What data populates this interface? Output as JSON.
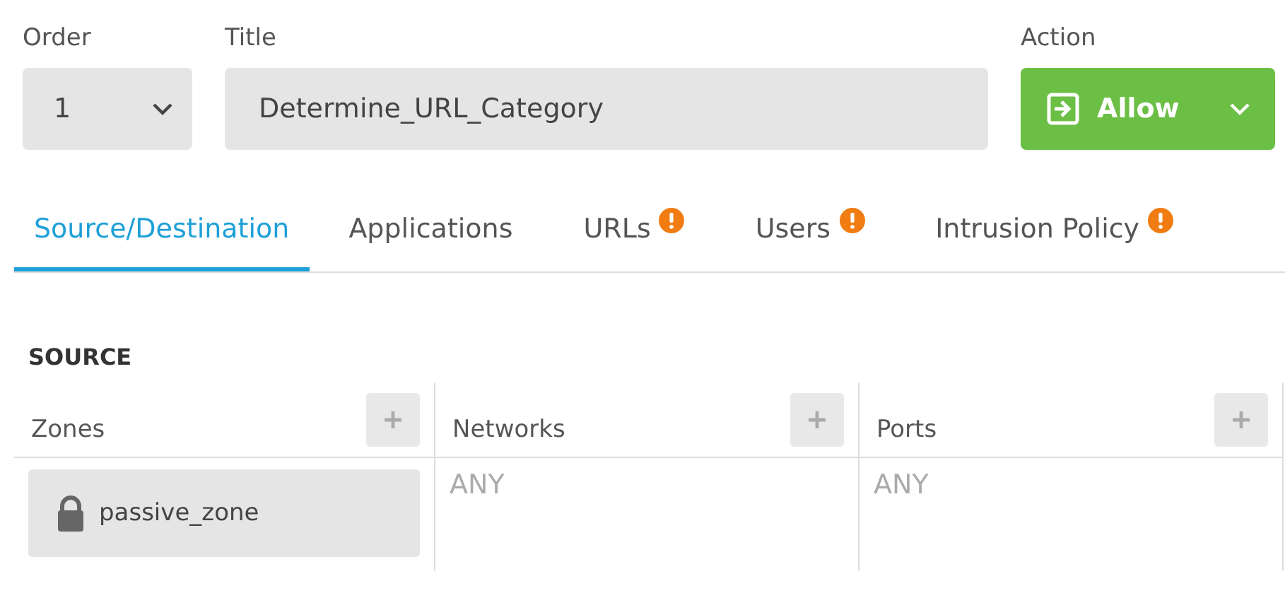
{
  "order": {
    "label": "Order",
    "value": "1"
  },
  "title": {
    "label": "Title",
    "value": "Determine_URL_Category"
  },
  "action": {
    "label": "Action",
    "value": "Allow"
  },
  "tabs": [
    {
      "label": "Source/Destination",
      "selected": true,
      "warning": false
    },
    {
      "label": "Applications",
      "selected": false,
      "warning": false
    },
    {
      "label": "URLs",
      "selected": false,
      "warning": true
    },
    {
      "label": "Users",
      "selected": false,
      "warning": true
    },
    {
      "label": "Intrusion Policy",
      "selected": false,
      "warning": true
    }
  ],
  "section": {
    "title": "SOURCE"
  },
  "columns": [
    {
      "heading": "Zones",
      "entries": [
        {
          "kind": "chip",
          "text": "passive_zone"
        }
      ]
    },
    {
      "heading": "Networks",
      "entries": [
        {
          "kind": "empty",
          "text": "ANY"
        }
      ]
    },
    {
      "heading": "Ports",
      "entries": [
        {
          "kind": "empty",
          "text": "ANY"
        }
      ]
    }
  ]
}
